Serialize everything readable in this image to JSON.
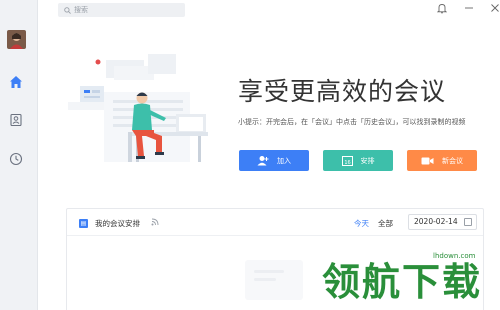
{
  "search": {
    "placeholder": "搜索"
  },
  "hero": {
    "title": "享受更高效的会议",
    "tip": "小提示：开完会后，在「会议」中点击「历史会议」，可以找到录制的视频"
  },
  "actions": {
    "join_label": "加入",
    "schedule_label": "安排",
    "new_label": "新会议"
  },
  "panel": {
    "title": "我的会议安排",
    "filter_today": "今天",
    "filter_all": "全部",
    "date": "2020-02-14"
  },
  "watermark": {
    "text": "领航下载",
    "url": "lhdown.com"
  },
  "colors": {
    "accent": "#3d7ff6",
    "schedule": "#3dbfaa",
    "new_meeting": "#ff8a47",
    "sidebar": "#f0f2f5"
  }
}
